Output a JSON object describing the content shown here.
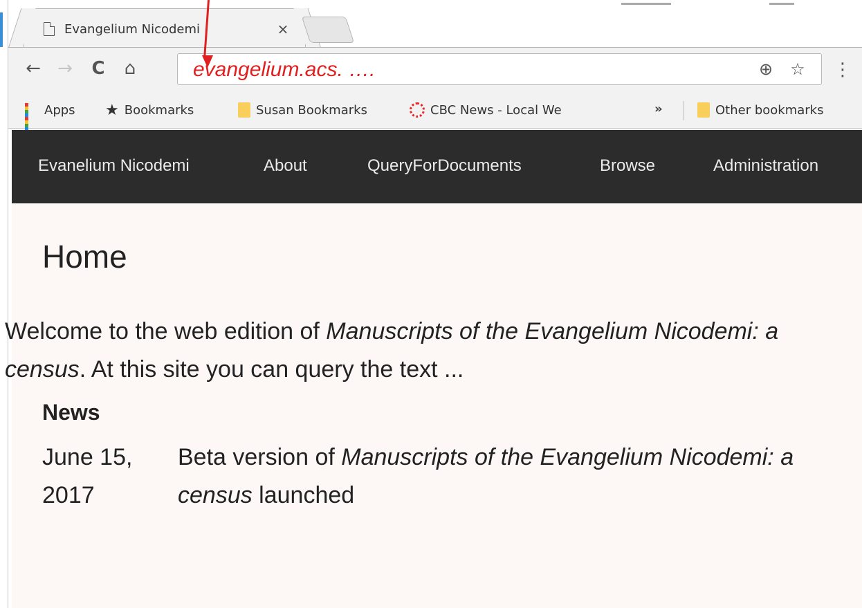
{
  "browser": {
    "tab": {
      "title": "Evangelium Nicodemi",
      "close": "×"
    },
    "nav": {
      "back": "←",
      "forward": "→",
      "reload": "C",
      "home": "⌂"
    },
    "address": {
      "url": "evangelium.acs. …."
    },
    "omnibox_icons": {
      "zoom": "⊕",
      "star": "☆"
    },
    "menu": "⋮",
    "bookmarks": {
      "items": [
        {
          "label": "Apps",
          "icon": "apps-grid-icon"
        },
        {
          "label": "Bookmarks",
          "icon": "star-icon"
        },
        {
          "label": "Susan Bookmarks",
          "icon": "folder-icon"
        },
        {
          "label": "CBC News - Local We",
          "icon": "cbc-icon"
        }
      ],
      "overflow": "»",
      "other": "Other bookmarks"
    }
  },
  "site": {
    "nav": [
      {
        "label": "Evanelium Nicodemi"
      },
      {
        "label": "About"
      },
      {
        "label": "QueryForDocuments"
      },
      {
        "label": "Browse"
      },
      {
        "label": "Administration"
      }
    ],
    "page_title": "Home",
    "welcome": {
      "prefix": "Welcome to the web edition of ",
      "title": "Manuscripts of the Evangelium Nicodemi: a census",
      "suffix": ". At this site you can query the text ..."
    },
    "news": {
      "heading": "News",
      "items": [
        {
          "date": "June 15, 2017",
          "text_prefix": "Beta version of ",
          "title": "Manuscripts of the Evangelium Nicodemi: a census",
          "text_suffix": " launched"
        }
      ]
    }
  },
  "colors": {
    "navbar_bg": "#2c2c2c",
    "page_bg": "#fdf8f5",
    "annotation_red": "#e02020"
  }
}
